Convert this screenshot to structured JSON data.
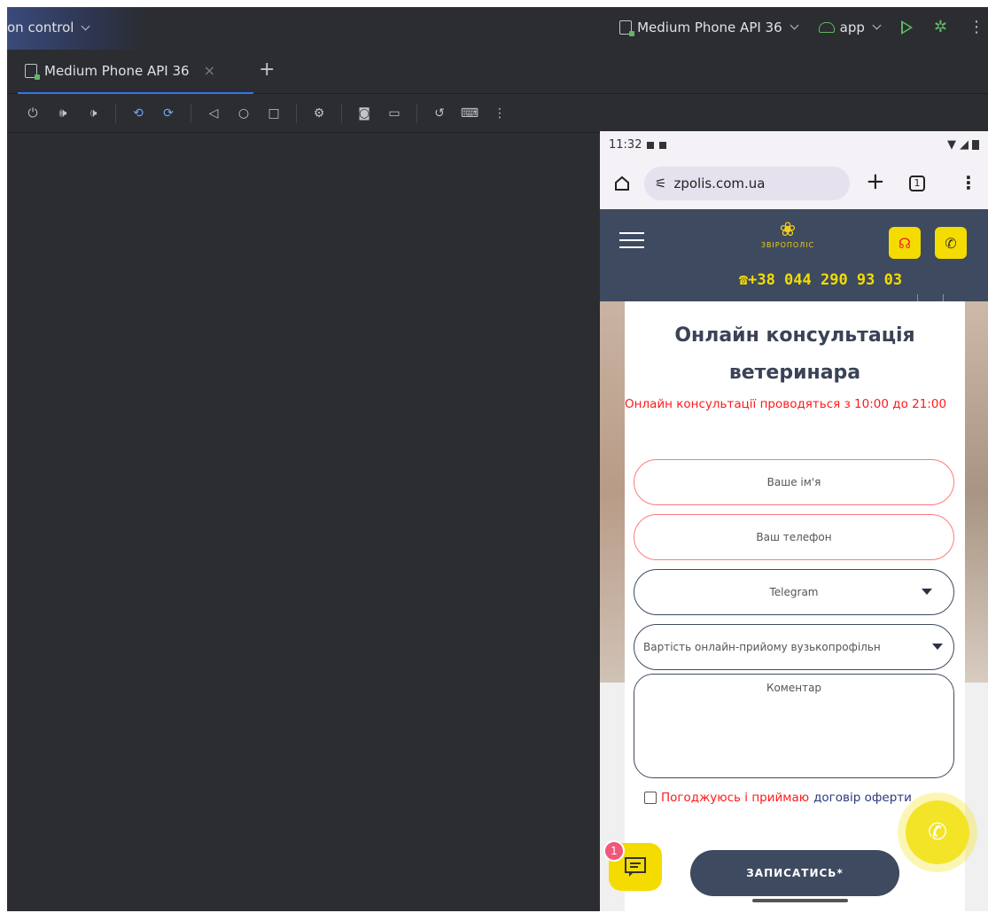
{
  "ide": {
    "version_control_label": "on control",
    "device_selector_label": "Medium Phone API 36",
    "run_config_label": "app",
    "tab_label": "Medium Phone API 36",
    "tab_close_glyph": "×",
    "tab_add_glyph": "+",
    "toolbar_icons": [
      "power-icon",
      "volume-up-icon",
      "volume-down-icon",
      "rotate-left-icon",
      "rotate-right-icon",
      "back-icon",
      "home-icon",
      "overview-icon",
      "device-settings-icon",
      "screenshot-icon",
      "screenrecord-icon",
      "snapshot-icon",
      "keyboard-icon",
      "more-icon"
    ]
  },
  "phone": {
    "status_time": "11:32",
    "url": "zpolis.com.ua",
    "tab_count": "1",
    "site_logo_text": "ЗВІРОПОЛІС",
    "site_phone": "☎+38 044 290 93 03",
    "form": {
      "title": "Онлайн консультація ветеринара",
      "note": "Онлайн консультації проводяться з 10:00 до 21:00",
      "name_placeholder": "Ваше ім'я",
      "phone_placeholder": "Ваш телефон",
      "messenger_value": "Telegram",
      "service_value": "Вартість онлайн-прийому вузькопрофільн",
      "comment_placeholder": "Коментар",
      "agree_text": "Погоджуюсь і приймаю",
      "agree_link": "договір оферти",
      "submit_label": "ЗАПИСАТИСЬ*"
    },
    "chat_badge": "1"
  },
  "colors": {
    "accent_yellow": "#f4dc00",
    "header_navy": "#3e4a60",
    "alert_red": "#ff1a1a",
    "ide_bg": "#2b2d30",
    "ide_tab_blue": "#3574f0"
  }
}
